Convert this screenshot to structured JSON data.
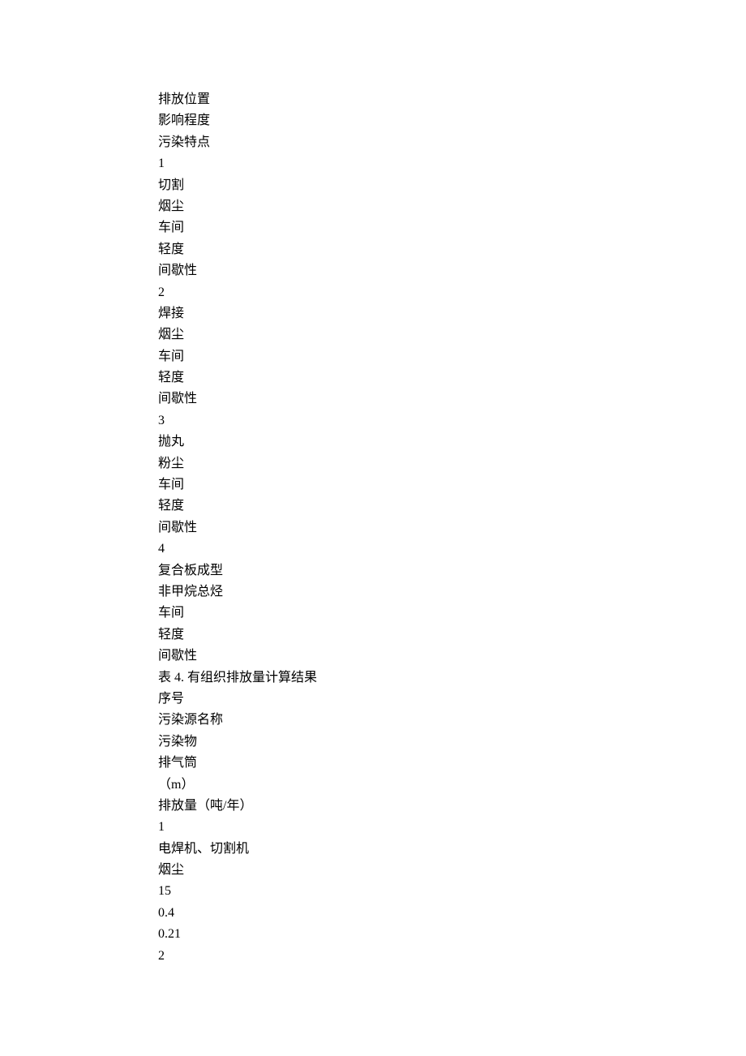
{
  "lines": [
    "排放位置",
    "影响程度",
    "污染特点",
    "1",
    "切割",
    "烟尘",
    "车间",
    "轻度",
    "间歇性",
    "2",
    "焊接",
    "烟尘",
    "车间",
    "轻度",
    "间歇性",
    "3",
    "抛丸",
    "粉尘",
    "车间",
    "轻度",
    "间歇性",
    "4",
    "复合板成型",
    "非甲烷总烃",
    "车间",
    "轻度",
    "间歇性",
    "表 4. 有组织排放量计算结果",
    "序号",
    "污染源名称",
    "污染物",
    "排气筒",
    "（m）",
    "排放量（吨/年）",
    "1",
    "电焊机、切割机",
    "烟尘",
    "15",
    "0.4",
    "0.21",
    "2"
  ]
}
